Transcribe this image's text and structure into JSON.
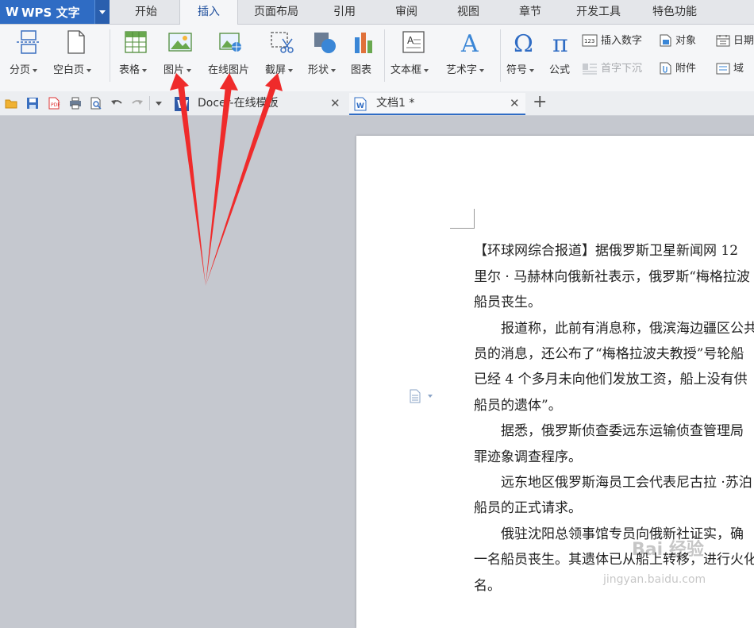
{
  "app": {
    "name": "WPS 文字"
  },
  "menu": {
    "tabs": [
      "开始",
      "插入",
      "页面布局",
      "引用",
      "审阅",
      "视图",
      "章节",
      "开发工具",
      "特色功能"
    ],
    "active": "插入"
  },
  "ribbon": {
    "page_break": "分页",
    "blank_page": "空白页",
    "table": "表格",
    "picture": "图片",
    "online_picture": "在线图片",
    "screenshot": "截屏",
    "shape": "形状",
    "chart": "图表",
    "textbox": "文本框",
    "wordart": "艺术字",
    "symbol": "符号",
    "formula": "公式",
    "insert_number": "插入数字",
    "object": "对象",
    "date": "日期",
    "dropcap": "首字下沉",
    "attachment": "附件",
    "field": "域"
  },
  "doc_tabs": [
    {
      "label": "Docer-在线模板"
    },
    {
      "label": "文档1 *"
    }
  ],
  "document": {
    "paragraphs": [
      "【环球网综合报道】据俄罗斯卫星新闻网 12",
      "里尔 · 马赫林向俄新社表示，俄罗斯“梅格拉波",
      "船员丧生。",
      "报道称，此前有消息称，俄滨海边疆区公共",
      "员的消息，还公布了“梅格拉波夫教授”号轮船",
      "已经 4 个多月未向他们发放工资，船上没有供",
      "船员的遗体”。",
      "据悉，俄罗斯侦查委远东运输侦查管理局",
      "罪迹象调查程序。",
      "远东地区俄罗斯海员工会代表尼古拉 ·苏泊",
      "船员的正式请求。",
      "俄驻沈阳总领事馆专员向俄新社证实，确",
      "一名船员丧生。其遗体已从船上转移，进行火化",
      "名。"
    ]
  },
  "watermark": {
    "line1": "Bai 经验",
    "line2": "jingyan.baidu.com"
  },
  "colors": {
    "accent": "#2f6cc4",
    "arrow": "#ef2b2b",
    "workspace": "#c5c8cf"
  }
}
